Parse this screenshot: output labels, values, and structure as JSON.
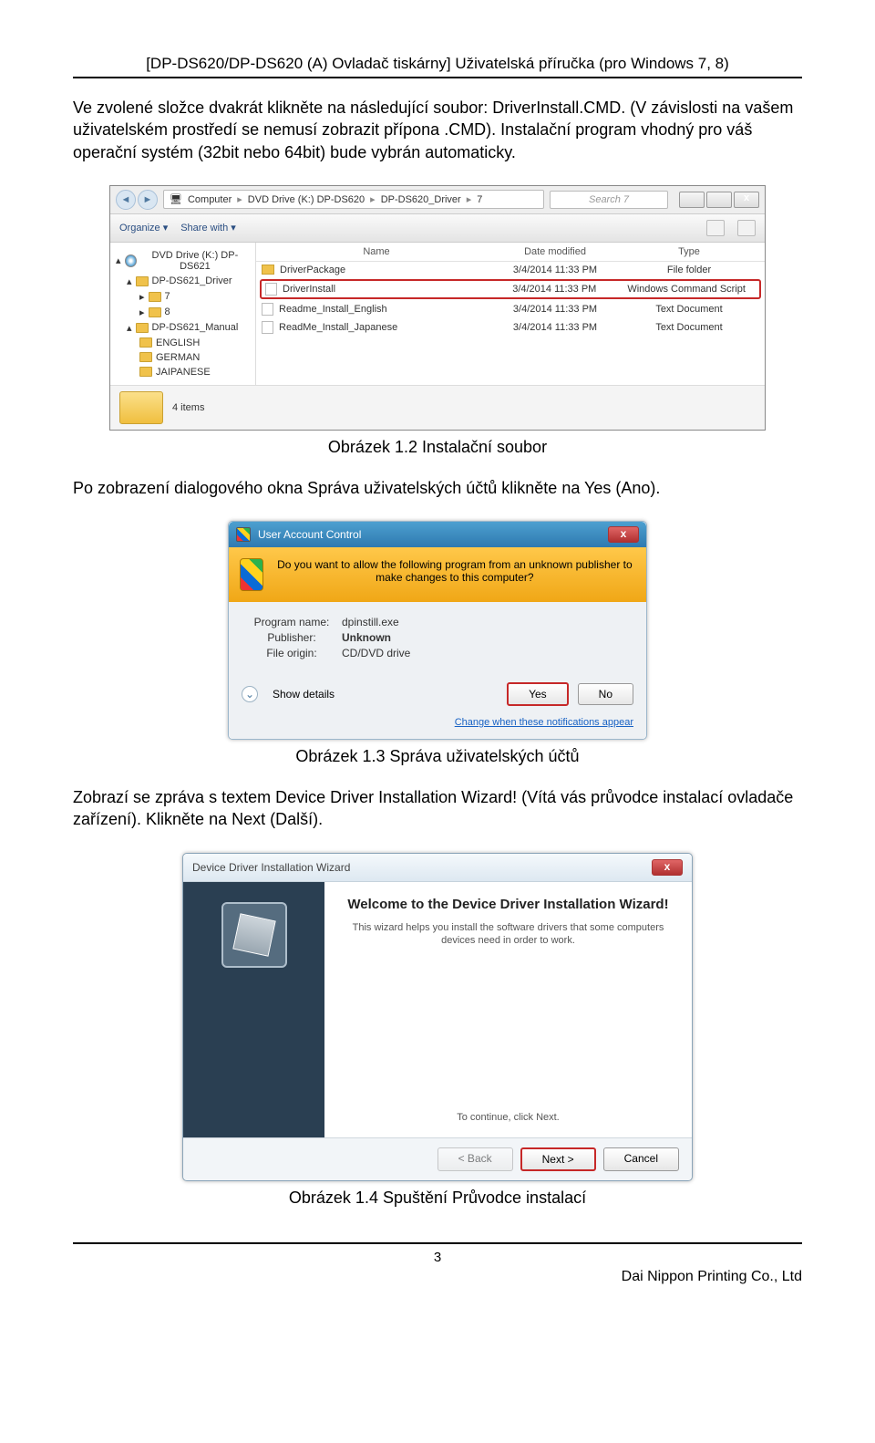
{
  "header": "[DP-DS620/DP-DS620 (A) Ovladač tiskárny] Uživatelská příručka (pro Windows 7, 8)",
  "para1": "Ve zvolené složce dvakrát klikněte na následující soubor: DriverInstall.CMD. (V závislosti na vašem uživatelském prostředí se nemusí zobrazit přípona .CMD). Instalační program vhodný pro váš operační systém (32bit nebo 64bit) bude vybrán automaticky.",
  "explorer": {
    "address": {
      "root": "Computer",
      "d1": "DVD Drive (K:) DP-DS620",
      "d2": "DP-DS620_Driver",
      "d3": "7"
    },
    "search_placeholder": "Search 7",
    "toolbar": {
      "organize": "Organize ▾",
      "share": "Share with ▾"
    },
    "tree": {
      "drive": "DVD Drive (K:) DP-DS621",
      "n1": "DP-DS621_Driver",
      "n2": "7",
      "n3": "8",
      "n4": "DP-DS621_Manual",
      "n5": "ENGLISH",
      "n6": "GERMAN",
      "n7": "JAIPANESE"
    },
    "cols": {
      "c1": "Name",
      "c2": "Date modified",
      "c3": "Type"
    },
    "rows": [
      {
        "name": "DriverPackage",
        "date": "3/4/2014 11:33 PM",
        "type": "File folder",
        "icon": "folder",
        "hl": false
      },
      {
        "name": "DriverInstall",
        "date": "3/4/2014 11:33 PM",
        "type": "Windows Command Script",
        "icon": "doc",
        "hl": true
      },
      {
        "name": "Readme_Install_English",
        "date": "3/4/2014 11:33 PM",
        "type": "Text Document",
        "icon": "doc",
        "hl": false
      },
      {
        "name": "ReadMe_Install_Japanese",
        "date": "3/4/2014 11:33 PM",
        "type": "Text Document",
        "icon": "doc",
        "hl": false
      }
    ],
    "status": "4 items"
  },
  "caption1": "Obrázek 1.2 Instalační soubor",
  "para2": "Po zobrazení dialogového okna Správa uživatelských účtů klikněte na Yes (Ano).",
  "uac": {
    "title": "User Account Control",
    "question": "Do you want to allow the following program from an unknown publisher to make changes to this computer?",
    "program_k": "Program name:",
    "program_v": "dpinstill.exe",
    "publisher_k": "Publisher:",
    "publisher_v": "Unknown",
    "origin_k": "File origin:",
    "origin_v": "CD/DVD drive",
    "show": "Show details",
    "yes": "Yes",
    "no": "No",
    "link": "Change when these notifications appear"
  },
  "caption2": "Obrázek 1.3 Správa uživatelských účtů",
  "para3": "Zobrazí se zpráva s textem Device Driver Installation Wizard! (Vítá vás průvodce instalací ovladače zařízení). Klikněte na Next (Další).",
  "wizard": {
    "title": "Device Driver Installation Wizard",
    "heading": "Welcome to the Device Driver Installation Wizard!",
    "desc": "This wizard helps you install the software drivers that some computers devices need in order to work.",
    "continue": "To continue, click Next.",
    "back": "< Back",
    "next": "Next >",
    "cancel": "Cancel"
  },
  "caption3": "Obrázek 1.4 Spuštění Průvodce instalací",
  "page_num": "3",
  "footer": "Dai Nippon Printing Co., Ltd"
}
